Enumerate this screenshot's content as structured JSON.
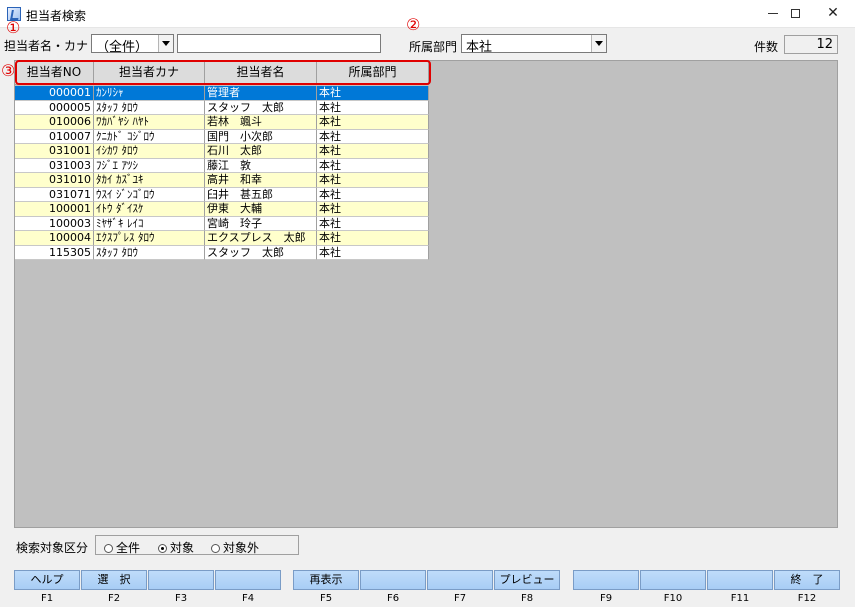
{
  "window": {
    "title": "担当者検索"
  },
  "markers": {
    "m1": "①",
    "m2": "②",
    "m3": "③"
  },
  "search": {
    "name_label": "担当者名・カナ",
    "name_mode": "（全件）",
    "name_value": "",
    "dept_label": "所属部門",
    "dept_value": "本社",
    "count_label": "件数",
    "count_value": "12"
  },
  "grid": {
    "columns": [
      "担当者NO",
      "担当者カナ",
      "担当者名",
      "所属部門"
    ],
    "rows": [
      {
        "no": "000001",
        "kana": "ｶﾝﾘｼｬ",
        "name": "管理者",
        "dept": "本社",
        "selected": true
      },
      {
        "no": "000005",
        "kana": "ｽﾀｯﾌ ﾀﾛｳ",
        "name": "スタッフ　太郎",
        "dept": "本社"
      },
      {
        "no": "010006",
        "kana": "ﾜｶﾊﾞﾔｼ ﾊﾔﾄ",
        "name": "若林　颯斗",
        "dept": "本社"
      },
      {
        "no": "010007",
        "kana": "ｸﾆｶﾄﾞ ｺｼﾞﾛｳ",
        "name": "国門　小次郎",
        "dept": "本社"
      },
      {
        "no": "031001",
        "kana": "ｲｼｶﾜ ﾀﾛｳ",
        "name": "石川　太郎",
        "dept": "本社"
      },
      {
        "no": "031003",
        "kana": "ﾌｼﾞｴ ｱﾂｼ",
        "name": "藤江　敦",
        "dept": "本社"
      },
      {
        "no": "031010",
        "kana": "ﾀｶｲ ｶｽﾞﾕｷ",
        "name": "高井　和幸",
        "dept": "本社"
      },
      {
        "no": "031071",
        "kana": "ｳｽｲ ｼﾞﾝｺﾞﾛｳ",
        "name": "臼井　甚五郎",
        "dept": "本社"
      },
      {
        "no": "100001",
        "kana": "ｲﾄｳ ﾀﾞｲｽｹ",
        "name": "伊東　大輔",
        "dept": "本社"
      },
      {
        "no": "100003",
        "kana": "ﾐﾔｻﾞｷ ﾚｲｺ",
        "name": "宮崎　玲子",
        "dept": "本社"
      },
      {
        "no": "100004",
        "kana": "ｴｸｽﾌﾟﾚｽ ﾀﾛｳ",
        "name": "エクスプレス　太郎",
        "dept": "本社"
      },
      {
        "no": "115305",
        "kana": "ｽﾀｯﾌ ﾀﾛｳ",
        "name": "スタッフ　太郎",
        "dept": "本社"
      }
    ]
  },
  "filter": {
    "label": "検索対象区分",
    "options": [
      {
        "label": "全件",
        "checked": false
      },
      {
        "label": "対象",
        "checked": true
      },
      {
        "label": "対象外",
        "checked": false
      }
    ]
  },
  "fkeys": [
    {
      "key": "F1",
      "label": "ヘルプ"
    },
    {
      "key": "F2",
      "label": "選　択"
    },
    {
      "key": "F3",
      "label": ""
    },
    {
      "key": "F4",
      "label": ""
    },
    {
      "key": "F5",
      "label": "再表示"
    },
    {
      "key": "F6",
      "label": ""
    },
    {
      "key": "F7",
      "label": ""
    },
    {
      "key": "F8",
      "label": "プレビュー"
    },
    {
      "key": "F9",
      "label": ""
    },
    {
      "key": "F10",
      "label": ""
    },
    {
      "key": "F11",
      "label": ""
    },
    {
      "key": "F12",
      "label": "終　了"
    }
  ]
}
